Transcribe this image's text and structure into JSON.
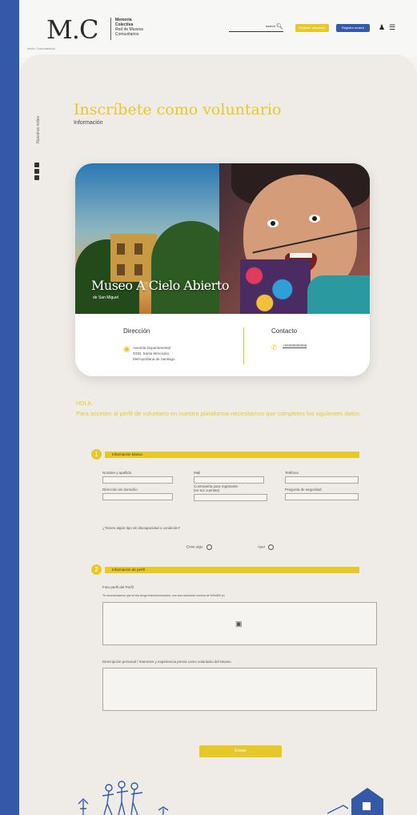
{
  "header": {
    "logo_mark": "M.C",
    "logo_lines": [
      "Memoria",
      "Colectiva",
      "Red de Museos",
      "Comunitarios"
    ],
    "search_label": "search",
    "register_volunteer_label": "Registro voluntario",
    "register_visitor_label": "Registro museo"
  },
  "breadcrumb": "Inicio / Voluntariado",
  "sidebar": {
    "social_label": "Nuestras redes",
    "icons": [
      "instagram-icon",
      "facebook-icon",
      "youtube-icon"
    ]
  },
  "page": {
    "title": "Inscríbete como voluntario",
    "subtitle": "Información"
  },
  "museum_card": {
    "title": "Museo A Cielo Abierto",
    "subtitle": "de San Miguel",
    "direccion_title": "Dirección",
    "direccion_lines": [
      "Avenida Departamental",
      "3330, Santa Mercedes,",
      "Metropolitana de Santiago"
    ],
    "contacto_title": "Contacto",
    "contacto_phone": "+56999999999"
  },
  "intro": {
    "greeting": "HOLA,",
    "text": "Para acceder al perfil de voluntario en nuestra plataforma necesitamos que completes los siguientes datos:"
  },
  "section1": {
    "number": "1",
    "label": "Información básica",
    "fields": {
      "nombre": "Nombre y apellido",
      "mail": "Mail",
      "telefono": "Teléfono",
      "direccion": "Dirección de domicilio",
      "contrasena_line1": "Contraseña para registrarte",
      "contrasena_line2": "(en tus cuentas)",
      "pregunta": "Pregunta de seguridad"
    },
    "radio_question": "¿Tienes algún tipo de discapacidad o condición?",
    "radio_options": [
      "Entre algo",
      "Ayer"
    ]
  },
  "section2": {
    "number": "2",
    "label": "Información de perfil",
    "photo_label": "Foto perfil del Perfil",
    "photo_hint": "Te recomendamos que la foto tenga buena iluminación, con una resolución mínima de 500x500 px",
    "description_label": "Descripción personal / Intereses y experiencia previa como voluntario del Museo"
  },
  "submit_label": "Enviar",
  "colors": {
    "brand_blue": "#3459a8",
    "accent_yellow": "#e6c928",
    "background": "#efece7"
  }
}
